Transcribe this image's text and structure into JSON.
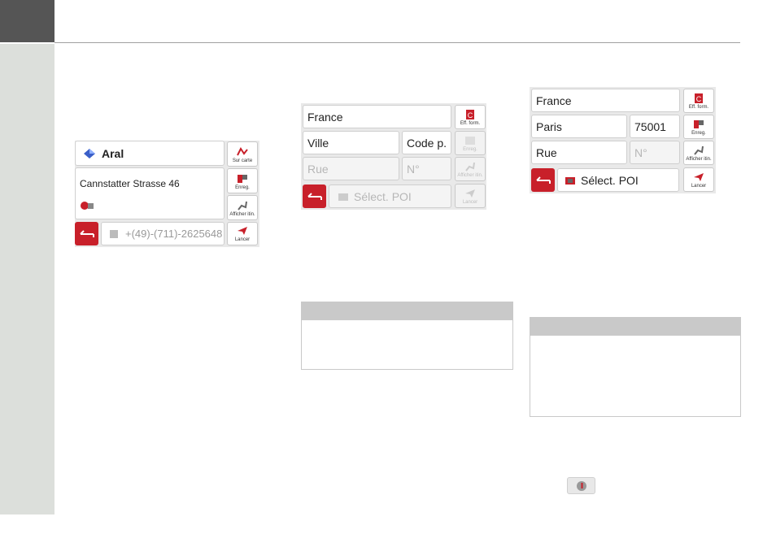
{
  "screen1": {
    "poi_name": "Aral",
    "address": "Cannstatter Strasse 46",
    "phone": "+(49)-(711)-2625648",
    "buttons": {
      "sur_carte": "Sur carte",
      "enreg": "Enreg.",
      "afficher": "Afficher itin.",
      "lancer": "Lancer"
    }
  },
  "screen2": {
    "country": "France",
    "city_placeholder": "Ville",
    "postcode_placeholder": "Code p.",
    "street_placeholder": "Rue",
    "number_placeholder": "N°",
    "poi_select": "Sélect. POI",
    "buttons": {
      "eff_form": "Eff. form.",
      "enreg": "Enreg.",
      "afficher": "Afficher itin.",
      "lancer": "Lancer"
    }
  },
  "screen3": {
    "country": "France",
    "city": "Paris",
    "postcode": "75001",
    "street_placeholder": "Rue",
    "number_placeholder": "N°",
    "poi_select": "Sélect. POI",
    "buttons": {
      "eff_form": "Eff. form.",
      "enreg": "Enreg.",
      "afficher": "Afficher itin.",
      "lancer": "Lancer"
    }
  },
  "colors": {
    "accent_red": "#c8202a",
    "sidebar": "#dcdfdb",
    "tab": "#555555"
  },
  "icons": [
    "diamond-arrow-icon",
    "map-icon",
    "save-icon",
    "route-icon",
    "launch-icon",
    "clear-form-icon",
    "back-arrow-icon",
    "phone-icon",
    "poi-icon",
    "info-icon"
  ]
}
